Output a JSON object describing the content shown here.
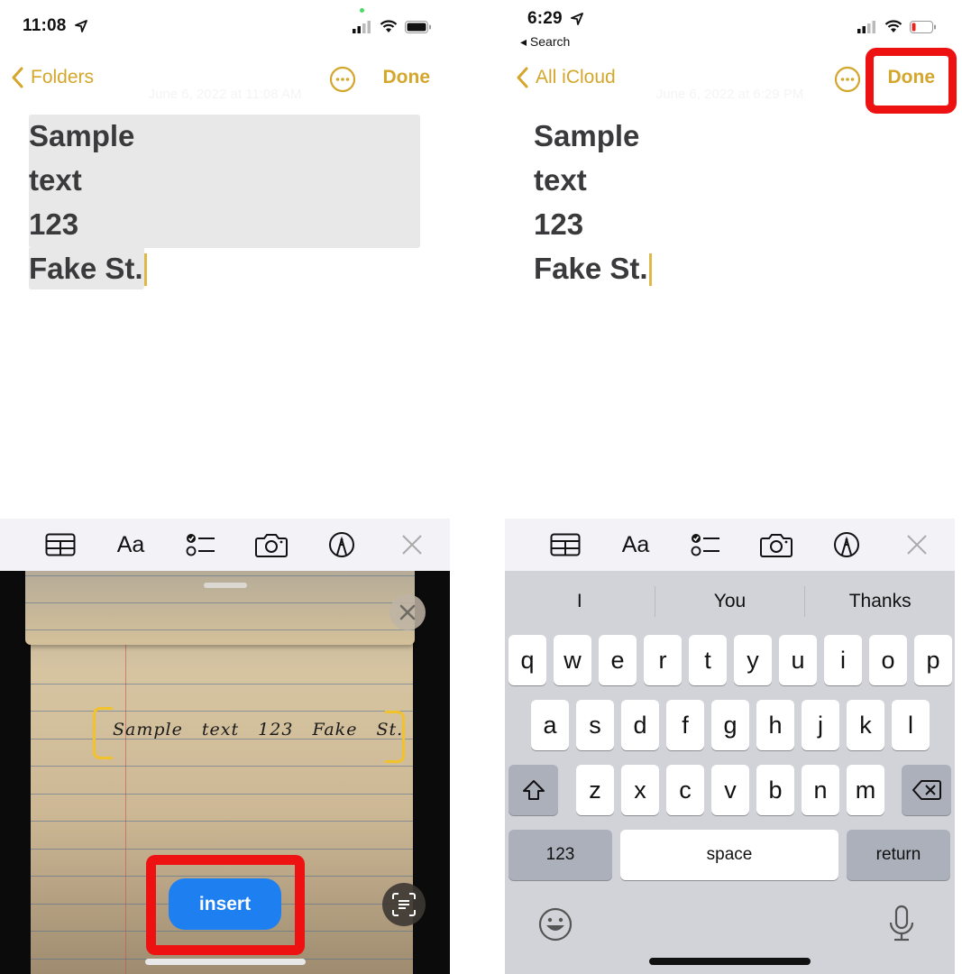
{
  "left_screen": {
    "status": {
      "time": "11:08",
      "icons": [
        "location-arrow-icon",
        "cellular-signal-icon",
        "wifi-icon",
        "battery-full-icon"
      ]
    },
    "nav": {
      "back_label": "Folders",
      "done_label": "Done"
    },
    "note": {
      "date": "June 6, 2022 at 11:08 AM",
      "lines": [
        "Sample",
        "text",
        "123",
        "Fake St."
      ]
    },
    "toolbar": {
      "icons": [
        "table-icon",
        "text-format-icon",
        "checklist-icon",
        "camera-icon",
        "markup-pen-icon",
        "close-icon"
      ],
      "format_label": "Aa"
    },
    "camera": {
      "handwritten_text": "Sample text 123 Fake St.",
      "insert_label": "insert"
    }
  },
  "right_screen": {
    "status": {
      "time": "6:29",
      "back_app": "◂ Search",
      "icons": [
        "location-arrow-icon",
        "cellular-signal-icon",
        "wifi-icon",
        "battery-low-icon"
      ]
    },
    "nav": {
      "back_label": "All iCloud",
      "done_label": "Done"
    },
    "note": {
      "date": "June 6, 2022 at 6:29 PM",
      "lines": [
        "Sample",
        "text",
        "123",
        "Fake St."
      ]
    },
    "toolbar": {
      "format_label": "Aa"
    },
    "keyboard": {
      "suggestions": [
        "I",
        "You",
        "Thanks"
      ],
      "row1": [
        "q",
        "w",
        "e",
        "r",
        "t",
        "y",
        "u",
        "i",
        "o",
        "p"
      ],
      "row2": [
        "a",
        "s",
        "d",
        "f",
        "g",
        "h",
        "j",
        "k",
        "l"
      ],
      "row3": [
        "z",
        "x",
        "c",
        "v",
        "b",
        "n",
        "m"
      ],
      "numbers_label": "123",
      "space_label": "space",
      "return_label": "return"
    }
  },
  "colors": {
    "accent": "#d4a72c",
    "highlight_red": "#ee1111",
    "insert_blue": "#1e7ff0",
    "keyboard_bg": "#d1d3d9"
  }
}
